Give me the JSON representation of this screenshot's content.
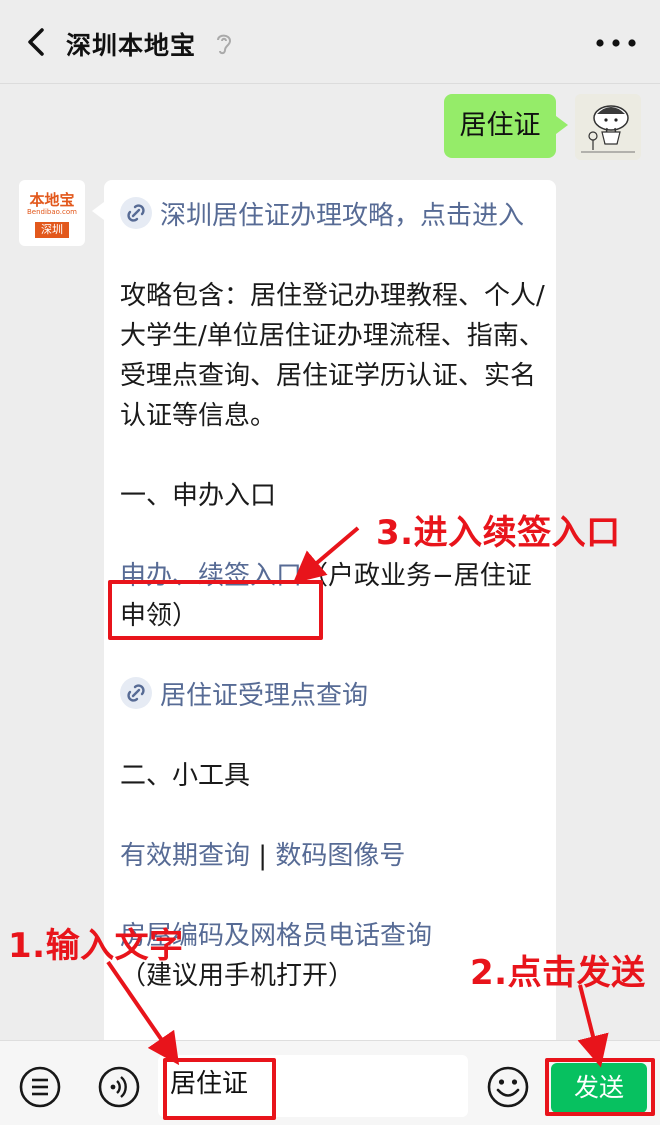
{
  "header": {
    "title": "深圳本地宝"
  },
  "messages": {
    "user_text": "居住证",
    "bot_avatar": {
      "logo_top": "本地宝",
      "logo_sub": "Bendibao.com",
      "logo_tag": "深圳"
    },
    "bot_lines": {
      "link1": "深圳居住证办理攻略，点击进入",
      "intro": "攻略包含：居住登记办理教程、个人/大学生/单位居住证办理流程、指南、受理点查询、居住证学历认证、实名认证等信息。",
      "section1": "一、申办入口",
      "apply_link": "申办、续签入口",
      "apply_note": "（户政业务−居住证申领）",
      "link2": "居住证受理点查询",
      "section2": "二、小工具",
      "tool_link1": "有效期查询",
      "tool_sep": " | ",
      "tool_link2": "数码图像号",
      "tool_link3": "房屋编码及网格员电话查询",
      "tool_note": "（建议用手机打开）"
    }
  },
  "annotations": {
    "step1": "1.输入文字",
    "step2": "2.点击发送",
    "step3": "3.进入续签入口",
    "accent_color": "#e8141b"
  },
  "input_bar": {
    "input_value": "居住证",
    "send_label": "发送"
  },
  "colors": {
    "background": "#ededed",
    "user_bubble": "#95ec69",
    "link": "#576b95",
    "send_button": "#07c160"
  }
}
